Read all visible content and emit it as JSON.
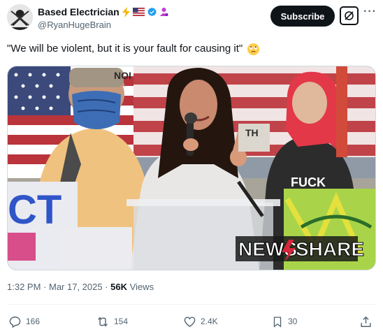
{
  "author": {
    "display_name": "Based Electrician",
    "handle": "@RyanHugeBrain",
    "avatar": "avatar-image"
  },
  "header": {
    "subscribe_label": "Subscribe",
    "grok_icon": "grok-icon",
    "more_icon": "more-icon",
    "badges": [
      "lightning-emoji",
      "us-flag-emoji",
      "verified-badge-icon",
      "person-emoji"
    ]
  },
  "tweet": {
    "text": "\"We will be violent, but it is your fault for causing it\"",
    "emoji": "eye-roll-emoji"
  },
  "media": {
    "watermark_left": "NEWS",
    "watermark_right": "SHARE",
    "sign_text_1": "CT",
    "sign_text_2": "FUCK",
    "hat_text": "NOI",
    "shirt_text": "TH"
  },
  "meta": {
    "time": "1:32 PM",
    "separator": " · ",
    "date": "Mar 17, 2025",
    "views_count": "56K",
    "views_label": " Views"
  },
  "actions": {
    "replies": "166",
    "reposts": "154",
    "likes": "2.4K",
    "bookmarks": "30"
  },
  "colors": {
    "brand_blue": "#1d9bf0",
    "text_secondary": "#536471",
    "button_dark": "#0f1419"
  }
}
